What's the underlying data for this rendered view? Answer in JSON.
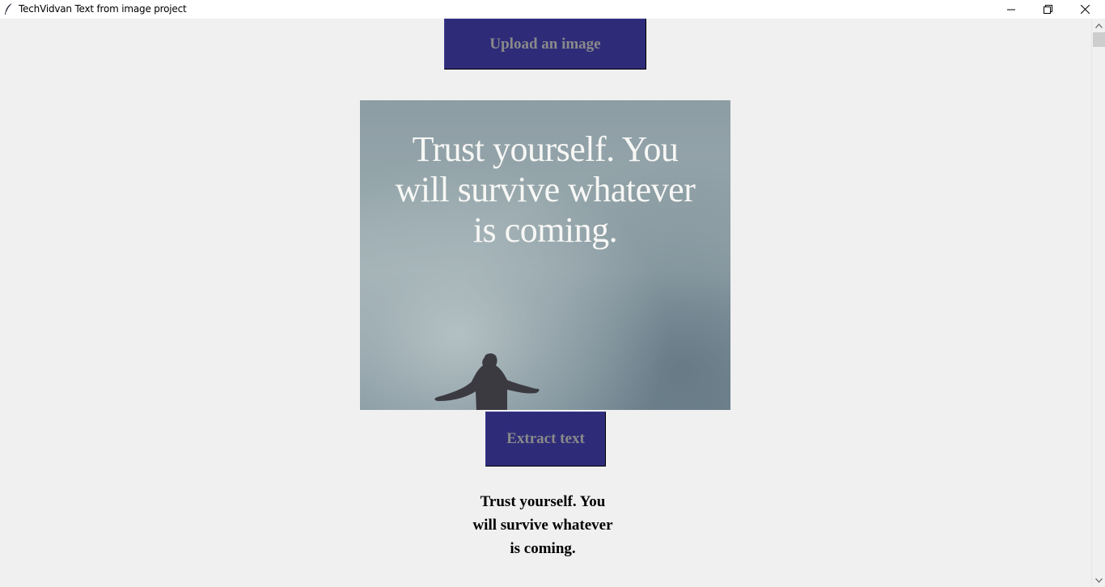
{
  "window": {
    "title": "TechVidvan Text from image project"
  },
  "buttons": {
    "upload_label": "Upload an image",
    "extract_label": "Extract text"
  },
  "image": {
    "quote_lines": [
      "Trust yourself. You",
      "will survive whatever",
      "is coming."
    ]
  },
  "result": {
    "lines": [
      "Trust yourself. You",
      "will survive whatever",
      "is coming."
    ]
  },
  "colors": {
    "button_bg": "#2e2c78",
    "button_text": "#8a8a8a",
    "background": "#f0f0f0"
  },
  "icons": {
    "app": "feather-icon",
    "minimize": "minimize-icon",
    "maximize": "restore-icon",
    "close": "close-icon",
    "scroll_up": "chevron-up-icon",
    "scroll_down": "chevron-down-icon"
  }
}
